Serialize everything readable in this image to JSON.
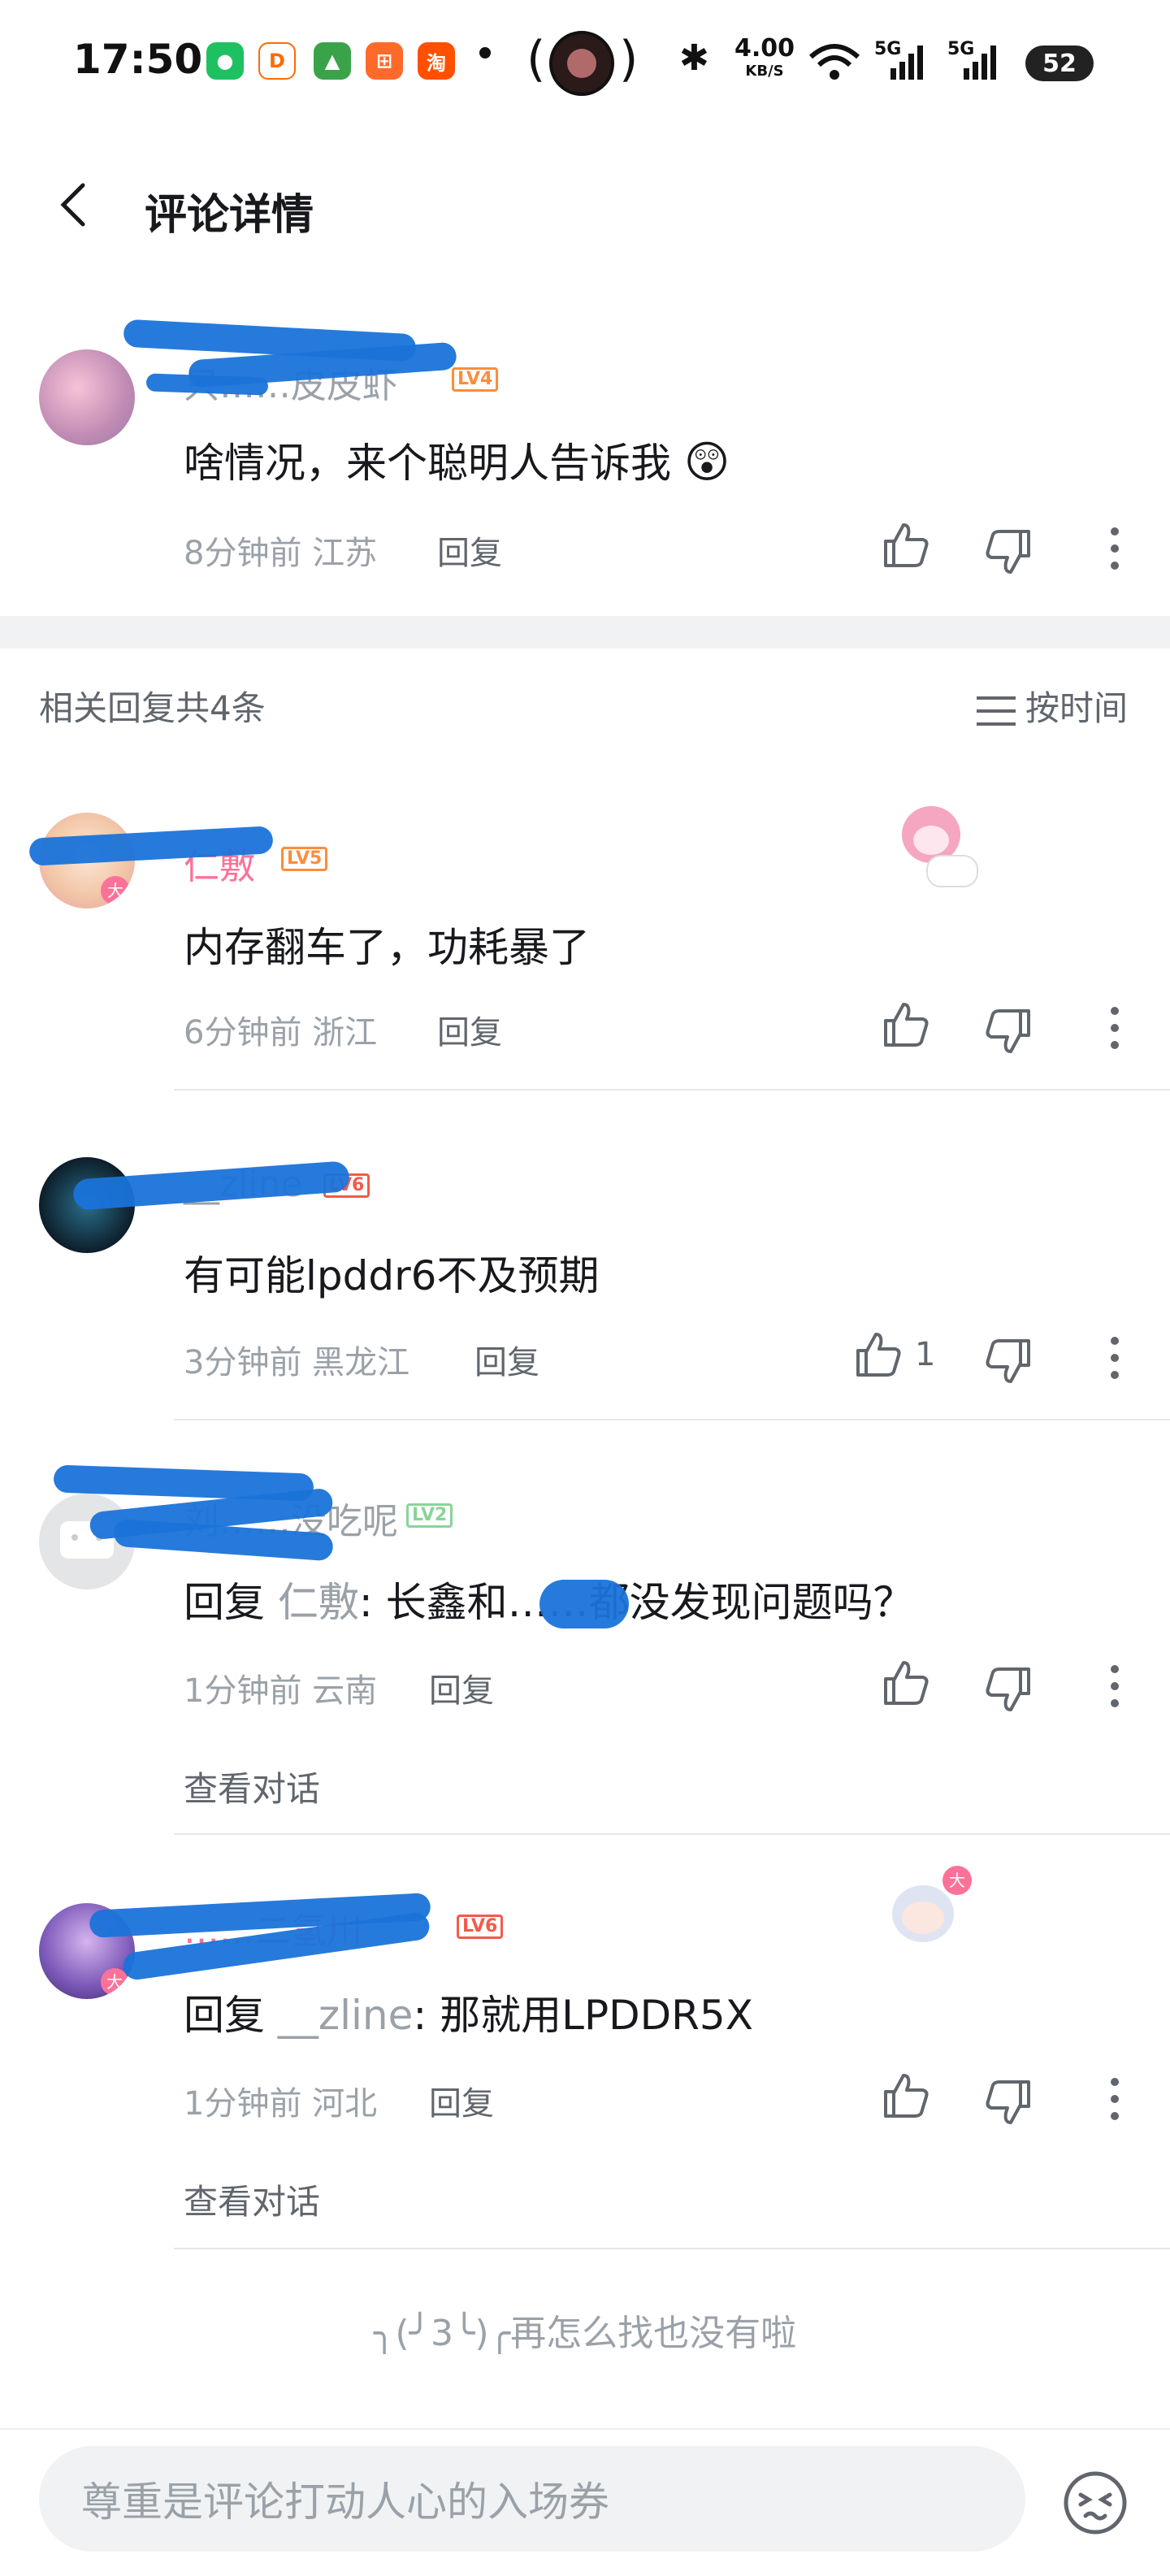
{
  "status_bar": {
    "time": "17:50",
    "net_speed": "4.00",
    "net_unit": "KB/S",
    "signal1": "5G",
    "signal2": "5G",
    "battery": "52"
  },
  "header": {
    "title": "评论详情"
  },
  "root_comment": {
    "username": "只……皮皮虾",
    "level": "LV4",
    "text": "啥情况，来个聪明人告诉我",
    "time": "8分钟前",
    "location": "江苏",
    "reply_label": "回复"
  },
  "replies_section": {
    "count_label": "相关回复共4条",
    "sort_label": "按时间"
  },
  "replies": [
    {
      "username": "仁敷",
      "level": "LV5",
      "text": "内存翻车了，功耗暴了",
      "time": "6分钟前",
      "location": "浙江",
      "reply_label": "回复"
    },
    {
      "username": "__zline",
      "level": "LV6",
      "text": "有可能lpddr6不及预期",
      "time": "3分钟前",
      "location": "黑龙江",
      "reply_label": "回复",
      "likes": "1"
    },
    {
      "username": "刘……没吃呢",
      "level": "LV2",
      "reply_prefix": "回复",
      "reply_to": "仁敷",
      "text": ": 长鑫和……都没发现问题吗？",
      "time": "1分钟前",
      "location": "云南",
      "reply_label": "回复",
      "view_conversation": "查看对话"
    },
    {
      "username": "……二氢川",
      "level": "LV6",
      "reply_prefix": "回复",
      "reply_to": "__zline",
      "text": ": 那就用LPDDR5X",
      "time": "1分钟前",
      "location": "河北",
      "reply_label": "回复",
      "view_conversation": "查看对话"
    }
  ],
  "end_text": "╮(╯3╰)╭再怎么找也没有啦",
  "input": {
    "placeholder": "尊重是评论打动人心的入场券"
  },
  "colors": {
    "pink": "#fb7299",
    "gray": "#9aa1a8",
    "scribble": "#1a73d9",
    "level_orange": "#ff8c3a",
    "level_green": "#8bd39a",
    "level_red": "#f45a4a"
  }
}
